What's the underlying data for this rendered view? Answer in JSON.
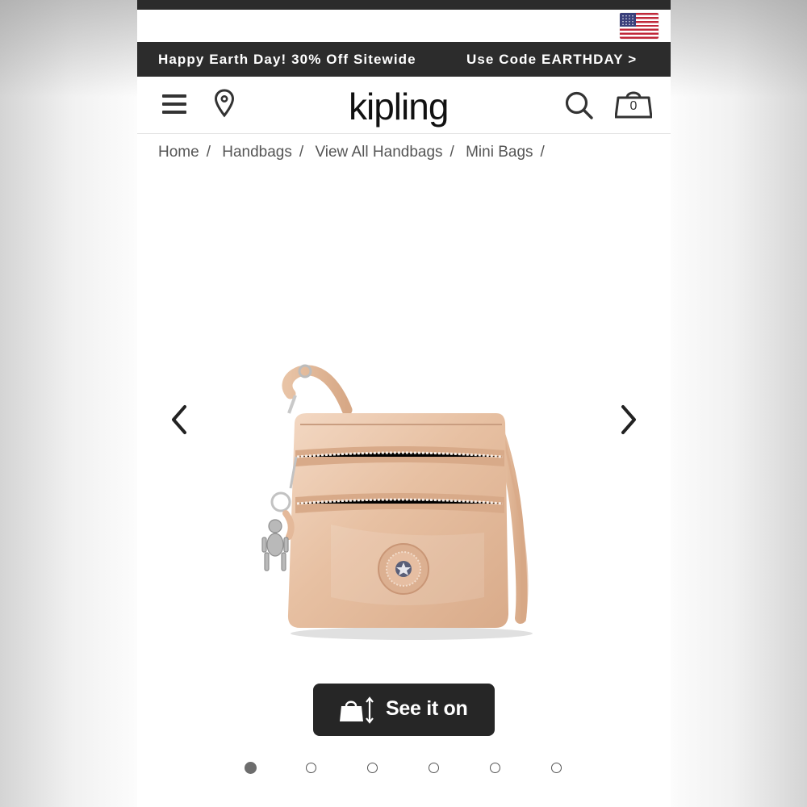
{
  "promo": {
    "left": "Happy Earth Day! 30% Off Sitewide",
    "right": "Use Code EARTHDAY >"
  },
  "header": {
    "logo": "kipling",
    "cart_count": "0",
    "icons": [
      "menu-icon",
      "location-pin-icon",
      "search-icon",
      "shopping-bag-icon",
      "us-flag-icon"
    ]
  },
  "breadcrumb": {
    "items": [
      {
        "label": "Home"
      },
      {
        "label": "Handbags"
      },
      {
        "label": "View All Handbags"
      },
      {
        "label": "Mini Bags"
      }
    ],
    "separator": "/"
  },
  "gallery": {
    "total_images": 6,
    "active_index": 0
  },
  "see_it_on": {
    "label": "See it on"
  },
  "colors": {
    "promo_bg": "#2c2c2c",
    "button_bg": "#262626",
    "bag_color": "#e7c3a7"
  }
}
